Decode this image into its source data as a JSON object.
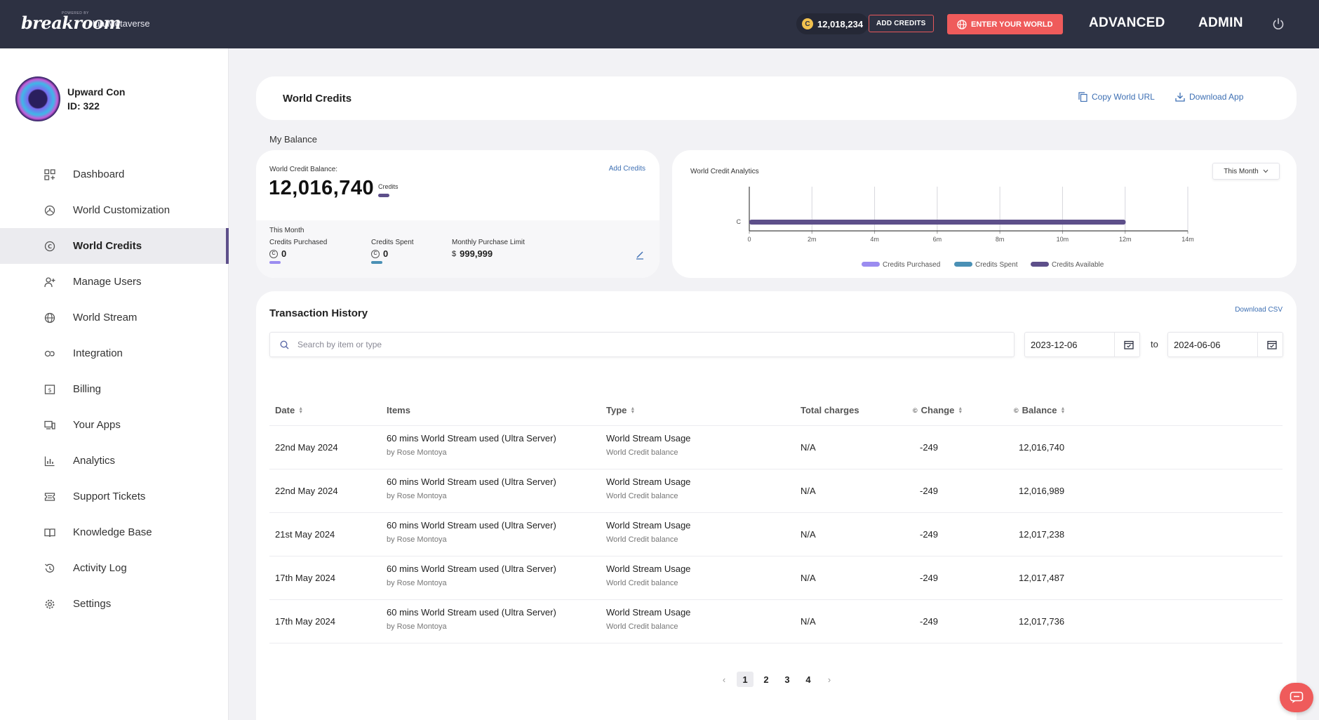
{
  "topbar": {
    "logo": "breakroom",
    "logo_sub": "POWERED BY",
    "org_name": "Lia Metaverse",
    "credits": "12,018,234",
    "add_credits": "ADD CREDITS",
    "enter_world": "ENTER YOUR WORLD",
    "nav_advanced": "ADVANCED",
    "nav_admin": "ADMIN"
  },
  "profile": {
    "name": "Upward Con",
    "id": "ID: 322"
  },
  "sidebar": {
    "items": [
      {
        "label": "Dashboard",
        "icon": "dashboard-icon"
      },
      {
        "label": "World Customization",
        "icon": "palette-icon"
      },
      {
        "label": "World Credits",
        "icon": "coin-icon",
        "active": true
      },
      {
        "label": "Manage Users",
        "icon": "user-add-icon"
      },
      {
        "label": "World Stream",
        "icon": "globe-icon"
      },
      {
        "label": "Integration",
        "icon": "link-icon"
      },
      {
        "label": "Billing",
        "icon": "bill-icon"
      },
      {
        "label": "Your Apps",
        "icon": "apps-icon"
      },
      {
        "label": "Analytics",
        "icon": "analytics-icon"
      },
      {
        "label": "Support Tickets",
        "icon": "ticket-icon"
      },
      {
        "label": "Knowledge Base",
        "icon": "book-icon"
      },
      {
        "label": "Activity Log",
        "icon": "history-icon"
      },
      {
        "label": "Settings",
        "icon": "gear-icon"
      }
    ]
  },
  "header": {
    "title": "World Credits",
    "copy_url": "Copy World URL",
    "download_app": "Download App"
  },
  "balance": {
    "section_label": "My Balance",
    "label": "World Credit Balance:",
    "add_credits": "Add Credits",
    "value": "12,016,740",
    "unit": "Credits",
    "this_month": "This Month",
    "purchased_label": "Credits Purchased",
    "purchased_value": "0",
    "spent_label": "Credits Spent",
    "spent_value": "0",
    "limit_label": "Monthly Purchase Limit",
    "limit_currency": "$",
    "limit_value": "999,999"
  },
  "analytics": {
    "title": "World Credit Analytics",
    "period": "This Month"
  },
  "chart_data": {
    "type": "bar",
    "orientation": "horizontal",
    "title": "World Credit Analytics",
    "categories": [
      "C"
    ],
    "x_ticks": [
      "0",
      "2m",
      "4m",
      "6m",
      "8m",
      "10m",
      "12m",
      "14m"
    ],
    "xlim": [
      0,
      14000000
    ],
    "grid": true,
    "legend_position": "bottom",
    "series": [
      {
        "name": "Credits Purchased",
        "color": "#9b8cf0",
        "values": [
          0
        ]
      },
      {
        "name": "Credits Spent",
        "color": "#4a90b5",
        "values": [
          0
        ]
      },
      {
        "name": "Credits Available",
        "color": "#5d4f8a",
        "values": [
          12016740
        ]
      }
    ]
  },
  "transactions": {
    "title": "Transaction History",
    "download_csv": "Download CSV",
    "search_placeholder": "Search by item or type",
    "date_from": "2023-12-06",
    "to_label": "to",
    "date_to": "2024-06-06",
    "columns": [
      "Date",
      "Items",
      "Type",
      "Total charges",
      "Change",
      "Balance"
    ],
    "rows": [
      {
        "date": "22nd May 2024",
        "item": "60 mins World Stream used (Ultra Server)",
        "by": "by Rose Montoya",
        "type": "World Stream Usage",
        "type_sub": "World Credit balance",
        "total": "N/A",
        "change": "-249",
        "balance": "12,016,740"
      },
      {
        "date": "22nd May 2024",
        "item": "60 mins World Stream used (Ultra Server)",
        "by": "by Rose Montoya",
        "type": "World Stream Usage",
        "type_sub": "World Credit balance",
        "total": "N/A",
        "change": "-249",
        "balance": "12,016,989"
      },
      {
        "date": "21st May 2024",
        "item": "60 mins World Stream used (Ultra Server)",
        "by": "by Rose Montoya",
        "type": "World Stream Usage",
        "type_sub": "World Credit balance",
        "total": "N/A",
        "change": "-249",
        "balance": "12,017,238"
      },
      {
        "date": "17th May 2024",
        "item": "60 mins World Stream used (Ultra Server)",
        "by": "by Rose Montoya",
        "type": "World Stream Usage",
        "type_sub": "World Credit balance",
        "total": "N/A",
        "change": "-249",
        "balance": "12,017,487"
      },
      {
        "date": "17th May 2024",
        "item": "60 mins World Stream used (Ultra Server)",
        "by": "by Rose Montoya",
        "type": "World Stream Usage",
        "type_sub": "World Credit balance",
        "total": "N/A",
        "change": "-249",
        "balance": "12,017,736"
      }
    ]
  },
  "pagination": {
    "pages": [
      "1",
      "2",
      "3",
      "4"
    ],
    "current": "1",
    "prev": "‹",
    "next": "›"
  },
  "colors": {
    "topbar": "#2d3142",
    "accent": "#ef5b5b",
    "link": "#3d6fb3",
    "active_indicator": "#5d4f8a"
  }
}
